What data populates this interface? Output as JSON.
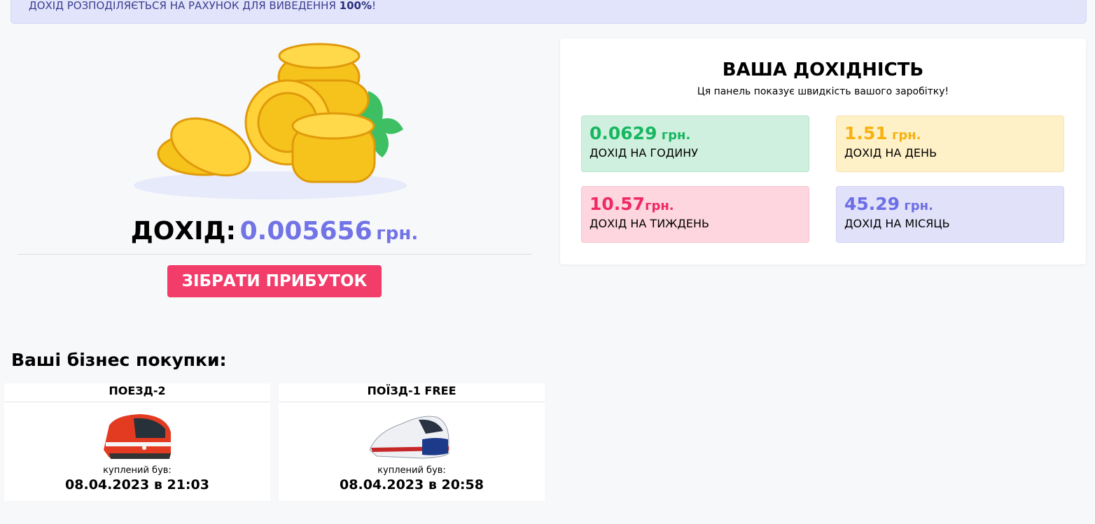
{
  "notice": {
    "text": "ДОХІД РОЗПОДІЛЯЄТЬСЯ НА РАХУНОК ДЛЯ ВИВЕДЕННЯ ",
    "bold": "100%",
    "tail": "!"
  },
  "income": {
    "label": "ДОХІД:",
    "value": "0.005656",
    "currency": "грн."
  },
  "collect_button": "ЗІБРАТИ ПРИБУТОК",
  "panel": {
    "title": "ВАША ДОХІДНІСТЬ",
    "subtitle": "Ця панель показує швидкість вашого заробітку!",
    "stats": {
      "hour": {
        "value": "0.0629",
        "unit": " грн.",
        "label": "ДОХІД НА ГОДИНУ"
      },
      "day": {
        "value": "1.51",
        "unit": " грн.",
        "label": "ДОХІД НА ДЕНЬ"
      },
      "week": {
        "value": "10.57",
        "unit": "грн.",
        "label": "ДОХІД НА ТИЖДЕНЬ"
      },
      "month": {
        "value": "45.29",
        "unit": " грн.",
        "label": "ДОХІД НА МІСЯЦЬ"
      }
    }
  },
  "purchases": {
    "title": "Ваші бізнес покупки:",
    "items": [
      {
        "name": "ПОЕЗД-2",
        "bought_label": "куплений був:",
        "date": "08.04.2023 в 21:03"
      },
      {
        "name": "ПОЇЗД-1 FREE",
        "bought_label": "куплений був:",
        "date": "08.04.2023 в 20:58"
      }
    ]
  },
  "colors": {
    "accent": "#7173e6",
    "button": "#f23c6a",
    "hour": "#17b65f",
    "day": "#f6b20f",
    "week": "#ef2a63",
    "month": "#6c6ee6"
  }
}
